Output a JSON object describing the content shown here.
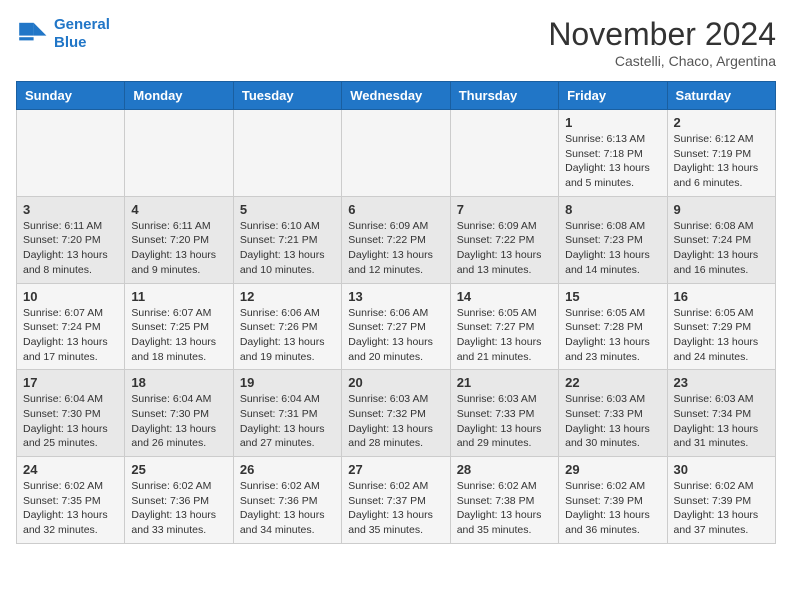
{
  "header": {
    "logo_line1": "General",
    "logo_line2": "Blue",
    "month_year": "November 2024",
    "location": "Castelli, Chaco, Argentina"
  },
  "weekdays": [
    "Sunday",
    "Monday",
    "Tuesday",
    "Wednesday",
    "Thursday",
    "Friday",
    "Saturday"
  ],
  "weeks": [
    [
      {
        "day": "",
        "info": ""
      },
      {
        "day": "",
        "info": ""
      },
      {
        "day": "",
        "info": ""
      },
      {
        "day": "",
        "info": ""
      },
      {
        "day": "",
        "info": ""
      },
      {
        "day": "1",
        "info": "Sunrise: 6:13 AM\nSunset: 7:18 PM\nDaylight: 13 hours\nand 5 minutes."
      },
      {
        "day": "2",
        "info": "Sunrise: 6:12 AM\nSunset: 7:19 PM\nDaylight: 13 hours\nand 6 minutes."
      }
    ],
    [
      {
        "day": "3",
        "info": "Sunrise: 6:11 AM\nSunset: 7:20 PM\nDaylight: 13 hours\nand 8 minutes."
      },
      {
        "day": "4",
        "info": "Sunrise: 6:11 AM\nSunset: 7:20 PM\nDaylight: 13 hours\nand 9 minutes."
      },
      {
        "day": "5",
        "info": "Sunrise: 6:10 AM\nSunset: 7:21 PM\nDaylight: 13 hours\nand 10 minutes."
      },
      {
        "day": "6",
        "info": "Sunrise: 6:09 AM\nSunset: 7:22 PM\nDaylight: 13 hours\nand 12 minutes."
      },
      {
        "day": "7",
        "info": "Sunrise: 6:09 AM\nSunset: 7:22 PM\nDaylight: 13 hours\nand 13 minutes."
      },
      {
        "day": "8",
        "info": "Sunrise: 6:08 AM\nSunset: 7:23 PM\nDaylight: 13 hours\nand 14 minutes."
      },
      {
        "day": "9",
        "info": "Sunrise: 6:08 AM\nSunset: 7:24 PM\nDaylight: 13 hours\nand 16 minutes."
      }
    ],
    [
      {
        "day": "10",
        "info": "Sunrise: 6:07 AM\nSunset: 7:24 PM\nDaylight: 13 hours\nand 17 minutes."
      },
      {
        "day": "11",
        "info": "Sunrise: 6:07 AM\nSunset: 7:25 PM\nDaylight: 13 hours\nand 18 minutes."
      },
      {
        "day": "12",
        "info": "Sunrise: 6:06 AM\nSunset: 7:26 PM\nDaylight: 13 hours\nand 19 minutes."
      },
      {
        "day": "13",
        "info": "Sunrise: 6:06 AM\nSunset: 7:27 PM\nDaylight: 13 hours\nand 20 minutes."
      },
      {
        "day": "14",
        "info": "Sunrise: 6:05 AM\nSunset: 7:27 PM\nDaylight: 13 hours\nand 21 minutes."
      },
      {
        "day": "15",
        "info": "Sunrise: 6:05 AM\nSunset: 7:28 PM\nDaylight: 13 hours\nand 23 minutes."
      },
      {
        "day": "16",
        "info": "Sunrise: 6:05 AM\nSunset: 7:29 PM\nDaylight: 13 hours\nand 24 minutes."
      }
    ],
    [
      {
        "day": "17",
        "info": "Sunrise: 6:04 AM\nSunset: 7:30 PM\nDaylight: 13 hours\nand 25 minutes."
      },
      {
        "day": "18",
        "info": "Sunrise: 6:04 AM\nSunset: 7:30 PM\nDaylight: 13 hours\nand 26 minutes."
      },
      {
        "day": "19",
        "info": "Sunrise: 6:04 AM\nSunset: 7:31 PM\nDaylight: 13 hours\nand 27 minutes."
      },
      {
        "day": "20",
        "info": "Sunrise: 6:03 AM\nSunset: 7:32 PM\nDaylight: 13 hours\nand 28 minutes."
      },
      {
        "day": "21",
        "info": "Sunrise: 6:03 AM\nSunset: 7:33 PM\nDaylight: 13 hours\nand 29 minutes."
      },
      {
        "day": "22",
        "info": "Sunrise: 6:03 AM\nSunset: 7:33 PM\nDaylight: 13 hours\nand 30 minutes."
      },
      {
        "day": "23",
        "info": "Sunrise: 6:03 AM\nSunset: 7:34 PM\nDaylight: 13 hours\nand 31 minutes."
      }
    ],
    [
      {
        "day": "24",
        "info": "Sunrise: 6:02 AM\nSunset: 7:35 PM\nDaylight: 13 hours\nand 32 minutes."
      },
      {
        "day": "25",
        "info": "Sunrise: 6:02 AM\nSunset: 7:36 PM\nDaylight: 13 hours\nand 33 minutes."
      },
      {
        "day": "26",
        "info": "Sunrise: 6:02 AM\nSunset: 7:36 PM\nDaylight: 13 hours\nand 34 minutes."
      },
      {
        "day": "27",
        "info": "Sunrise: 6:02 AM\nSunset: 7:37 PM\nDaylight: 13 hours\nand 35 minutes."
      },
      {
        "day": "28",
        "info": "Sunrise: 6:02 AM\nSunset: 7:38 PM\nDaylight: 13 hours\nand 35 minutes."
      },
      {
        "day": "29",
        "info": "Sunrise: 6:02 AM\nSunset: 7:39 PM\nDaylight: 13 hours\nand 36 minutes."
      },
      {
        "day": "30",
        "info": "Sunrise: 6:02 AM\nSunset: 7:39 PM\nDaylight: 13 hours\nand 37 minutes."
      }
    ]
  ]
}
